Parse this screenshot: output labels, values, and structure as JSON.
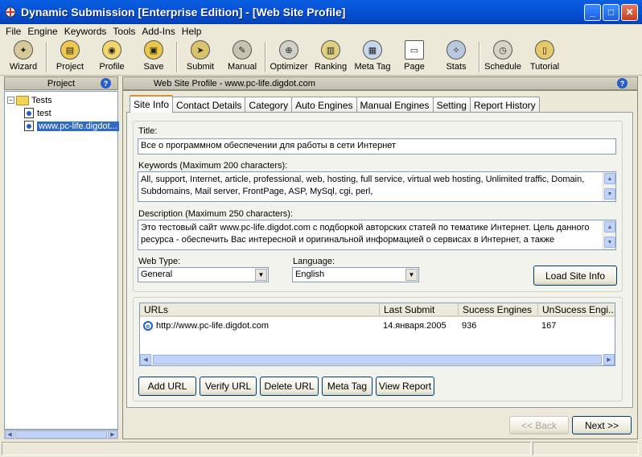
{
  "window": {
    "title": "Dynamic Submission [Enterprise Edition] - [Web Site Profile]"
  },
  "menu": [
    "File",
    "Engine",
    "Keywords",
    "Tools",
    "Add-Ins",
    "Help"
  ],
  "toolbar": [
    {
      "label": "Wizard",
      "icon": "wizard-icon"
    },
    {
      "label": "Project",
      "icon": "project-icon"
    },
    {
      "label": "Profile",
      "icon": "profile-icon"
    },
    {
      "label": "Save",
      "icon": "save-icon"
    },
    {
      "label": "Submit",
      "icon": "submit-icon"
    },
    {
      "label": "Manual",
      "icon": "manual-icon"
    },
    {
      "label": "Optimizer",
      "icon": "optimizer-icon"
    },
    {
      "label": "Ranking",
      "icon": "ranking-icon"
    },
    {
      "label": "Meta Tag",
      "icon": "meta-tag-icon"
    },
    {
      "label": "Page",
      "icon": "page-icon"
    },
    {
      "label": "Stats",
      "icon": "stats-icon"
    },
    {
      "label": "Schedule",
      "icon": "schedule-icon"
    },
    {
      "label": "Tutorial",
      "icon": "tutorial-icon"
    }
  ],
  "left_panel": {
    "header": "Project",
    "tree": {
      "root": "Tests",
      "children": [
        "test",
        "www.pc-life.digdot..."
      ]
    }
  },
  "right_panel": {
    "header": "Web Site Profile - www.pc-life.digdot.com"
  },
  "tabs": [
    "Site Info",
    "Contact Details",
    "Category",
    "Auto Engines",
    "Manual Engines",
    "Setting",
    "Report History"
  ],
  "site_info": {
    "title_label": "Title:",
    "title_value": "Все о программном обеспечении для работы в сети Интернет",
    "keywords_label": "Keywords (Maximum 200 characters):",
    "keywords_line1": "All, support, Internet, article, professional, web, hosting, full service, virtual web hosting, Unlimited traffic, Domain,",
    "keywords_line2": "Subdomains, Mail server, FrontPage, ASP, MySql, cgi, perl,",
    "description_label": "Description (Maximum 250 characters):",
    "description_line1": "Это тестовый сайт www.pc-life.digdot.com с подборкой авторских статей по тематике Интернет. Цель данного",
    "description_line2": "ресурса - обеспечить Вас интересной и оригинальной информацией о сервисах в Интернет, а также проверить",
    "web_type_label": "Web Type:",
    "web_type_value": "General",
    "language_label": "Language:",
    "language_value": "English",
    "load_button": "Load Site Info"
  },
  "urls": {
    "columns": [
      "URLs",
      "Last Submit",
      "Sucess Engines",
      "UnSucess Engi..."
    ],
    "rows": [
      {
        "url": "http://www.pc-life.digdot.com",
        "last_submit": "14.января.2005",
        "success": "936",
        "unsuccess": "167"
      }
    ],
    "buttons": [
      "Add URL",
      "Verify URL",
      "Delete URL",
      "Meta Tag",
      "View Report"
    ]
  },
  "nav": {
    "back": "<< Back",
    "next": "Next >>"
  }
}
